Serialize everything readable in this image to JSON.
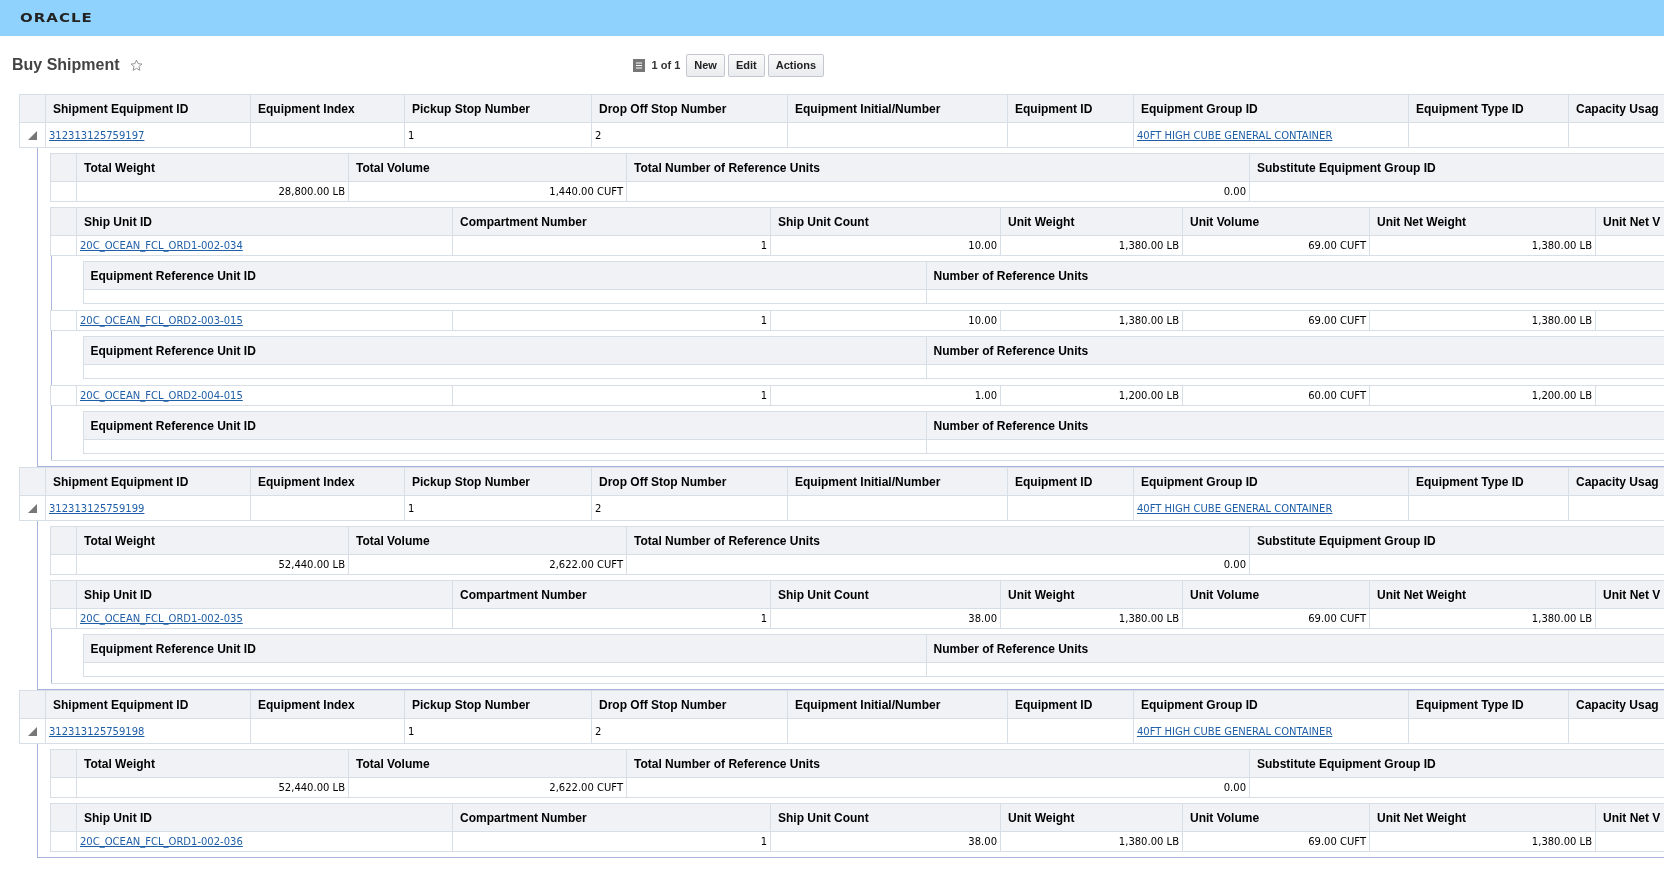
{
  "brand": {
    "logo": "ORACLE"
  },
  "page": {
    "title": "Buy Shipment",
    "favorite": false
  },
  "toolbar": {
    "record_count": "1 of 1",
    "buttons": [
      "New",
      "Edit",
      "Actions"
    ]
  },
  "groups": [
    {
      "expanded": true,
      "columns": [
        "Shipment Equipment ID",
        "Equipment Index",
        "Pickup Stop Number",
        "Drop Off Stop Number",
        "Equipment Initial/Number",
        "Equipment ID",
        "Equipment Group ID",
        "Equipment Type ID",
        "Capacity Usag"
      ],
      "row": {
        "shipment_equipment_id": "312313125759197",
        "pickup_stop_number": "1",
        "drop_off_stop_number": "2",
        "equipment_group_id": "40FT HIGH CUBE GENERAL CONTAINER"
      },
      "summary": {
        "columns": [
          "Total Weight",
          "Total Volume",
          "Total Number of Reference Units",
          "Substitute Equipment Group ID"
        ],
        "total_weight": "28,800.00 LB",
        "total_volume": "1,440.00 CUFT",
        "total_reference_units": "0.00"
      },
      "ship_unit_columns": [
        "Ship Unit ID",
        "Compartment Number",
        "Ship Unit Count",
        "Unit Weight",
        "Unit Volume",
        "Unit Net Weight",
        "Unit Net V"
      ],
      "ship_units": [
        {
          "ship_unit_id": "20C_OCEAN_FCL_ORD1-002-034",
          "compartment_number": "1",
          "ship_unit_count": "10.00",
          "unit_weight": "1,380.00 LB",
          "unit_volume": "69.00 CUFT",
          "unit_net_weight": "1,380.00 LB",
          "reference_columns": [
            "Equipment Reference Unit ID",
            "Number of Reference Units"
          ]
        },
        {
          "ship_unit_id": "20C_OCEAN_FCL_ORD2-003-015",
          "compartment_number": "1",
          "ship_unit_count": "10.00",
          "unit_weight": "1,380.00 LB",
          "unit_volume": "69.00 CUFT",
          "unit_net_weight": "1,380.00 LB",
          "reference_columns": [
            "Equipment Reference Unit ID",
            "Number of Reference Units"
          ]
        },
        {
          "ship_unit_id": "20C_OCEAN_FCL_ORD2-004-015",
          "compartment_number": "1",
          "ship_unit_count": "1.00",
          "unit_weight": "1,200.00 LB",
          "unit_volume": "60.00 CUFT",
          "unit_net_weight": "1,200.00 LB",
          "reference_columns": [
            "Equipment Reference Unit ID",
            "Number of Reference Units"
          ]
        }
      ]
    },
    {
      "expanded": true,
      "columns": [
        "Shipment Equipment ID",
        "Equipment Index",
        "Pickup Stop Number",
        "Drop Off Stop Number",
        "Equipment Initial/Number",
        "Equipment ID",
        "Equipment Group ID",
        "Equipment Type ID",
        "Capacity Usag"
      ],
      "row": {
        "shipment_equipment_id": "312313125759199",
        "pickup_stop_number": "1",
        "drop_off_stop_number": "2",
        "equipment_group_id": "40FT HIGH CUBE GENERAL CONTAINER"
      },
      "summary": {
        "columns": [
          "Total Weight",
          "Total Volume",
          "Total Number of Reference Units",
          "Substitute Equipment Group ID"
        ],
        "total_weight": "52,440.00 LB",
        "total_volume": "2,622.00 CUFT",
        "total_reference_units": "0.00"
      },
      "ship_unit_columns": [
        "Ship Unit ID",
        "Compartment Number",
        "Ship Unit Count",
        "Unit Weight",
        "Unit Volume",
        "Unit Net Weight",
        "Unit Net V"
      ],
      "ship_units": [
        {
          "ship_unit_id": "20C_OCEAN_FCL_ORD1-002-035",
          "compartment_number": "1",
          "ship_unit_count": "38.00",
          "unit_weight": "1,380.00 LB",
          "unit_volume": "69.00 CUFT",
          "unit_net_weight": "1,380.00 LB",
          "reference_columns": [
            "Equipment Reference Unit ID",
            "Number of Reference Units"
          ]
        }
      ]
    },
    {
      "expanded": true,
      "columns": [
        "Shipment Equipment ID",
        "Equipment Index",
        "Pickup Stop Number",
        "Drop Off Stop Number",
        "Equipment Initial/Number",
        "Equipment ID",
        "Equipment Group ID",
        "Equipment Type ID",
        "Capacity Usag"
      ],
      "row": {
        "shipment_equipment_id": "312313125759198",
        "pickup_stop_number": "1",
        "drop_off_stop_number": "2",
        "equipment_group_id": "40FT HIGH CUBE GENERAL CONTAINER"
      },
      "summary": {
        "columns": [
          "Total Weight",
          "Total Volume",
          "Total Number of Reference Units",
          "Substitute Equipment Group ID"
        ],
        "total_weight": "52,440.00 LB",
        "total_volume": "2,622.00 CUFT",
        "total_reference_units": "0.00"
      },
      "ship_unit_columns": [
        "Ship Unit ID",
        "Compartment Number",
        "Ship Unit Count",
        "Unit Weight",
        "Unit Volume",
        "Unit Net Weight",
        "Unit Net V"
      ],
      "ship_units": [
        {
          "ship_unit_id": "20C_OCEAN_FCL_ORD1-002-036",
          "compartment_number": "1",
          "ship_unit_count": "38.00",
          "unit_weight": "1,380.00 LB",
          "unit_volume": "69.00 CUFT",
          "unit_net_weight": "1,380.00 LB"
        }
      ]
    }
  ]
}
